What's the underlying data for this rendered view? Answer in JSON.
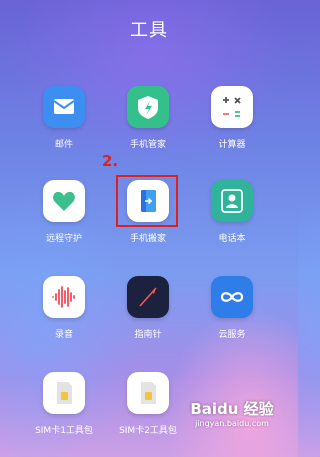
{
  "folder": {
    "title": "工具"
  },
  "apps": [
    {
      "label": "邮件",
      "icon": "mail-icon",
      "color": "#3c8ef0"
    },
    {
      "label": "手机管家",
      "icon": "shield-icon",
      "color": "#34c08b"
    },
    {
      "label": "计算器",
      "icon": "calculator-icon",
      "color": "#ffffff"
    },
    {
      "label": "远程守护",
      "icon": "heart-icon",
      "color": "#ffffff"
    },
    {
      "label": "手机搬家",
      "icon": "phone-clone-icon",
      "color": "#ffffff"
    },
    {
      "label": "电话本",
      "icon": "contact-icon",
      "color": "#2fb39a"
    },
    {
      "label": "录音",
      "icon": "recorder-icon",
      "color": "#ffffff"
    },
    {
      "label": "指南针",
      "icon": "compass-icon",
      "color": "#1c2140"
    },
    {
      "label": "云服务",
      "icon": "cloud-service-icon",
      "color": "#2f7de9"
    },
    {
      "label": "SIM卡1工具包",
      "icon": "sim-card-icon",
      "color": "#ffffff"
    },
    {
      "label": "SIM卡2工具包",
      "icon": "sim-card-icon",
      "color": "#ffffff"
    }
  ],
  "annotation": {
    "step": "2."
  },
  "watermark": {
    "logo": "Baidu 经验",
    "site": "jingyan.baidu.com"
  }
}
